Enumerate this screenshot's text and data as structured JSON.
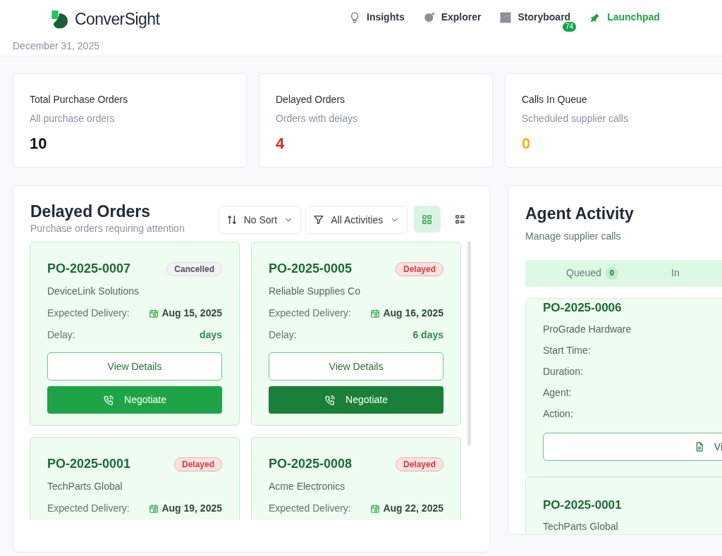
{
  "header": {
    "brand": "ConverSight",
    "date": "December 31, 2025",
    "nav": [
      {
        "label": "Insights",
        "kind": "insights",
        "selected": false
      },
      {
        "label": "Explorer",
        "kind": "explorer",
        "selected": false
      },
      {
        "label": "Storyboard",
        "kind": "storyboard",
        "selected": false,
        "badge": "74"
      },
      {
        "label": "Launchpad",
        "kind": "launchpad",
        "selected": true
      }
    ]
  },
  "stats": [
    {
      "title": "Total Purchase Orders",
      "subtitle": "All purchase orders",
      "value": "10",
      "color": "#111111"
    },
    {
      "title": "Delayed Orders",
      "subtitle": "Orders with delays",
      "value": "4",
      "color": "#dc2626"
    },
    {
      "title": "Calls In Queue",
      "subtitle": "Scheduled supplier calls",
      "value": "0",
      "color": "#f5b014"
    }
  ],
  "delayed_orders": {
    "title": "Delayed Orders",
    "subtitle": "Purchase orders requiring attention",
    "sort": {
      "label": "No Sort"
    },
    "filter": {
      "label": "All Activities"
    },
    "views": [
      {
        "kind": "grid",
        "selected": true
      },
      {
        "kind": "list",
        "selected": false
      }
    ],
    "orders": [
      {
        "id": "PO-2025-0007",
        "status": "Cancelled",
        "kind": "cancelled",
        "supplier": "DeviceLink Solutions",
        "delivery_label": "Expected Delivery:",
        "delivery": "Aug 15, 2025",
        "delay_label": "Delay:",
        "delay": "days",
        "view_label": "View Details",
        "negotiate_label": "Negotiate",
        "negotiate_hovered": false
      },
      {
        "id": "PO-2025-0005",
        "status": "Delayed",
        "kind": "delayed",
        "supplier": "Reliable Supplies Co",
        "delivery_label": "Expected Delivery:",
        "delivery": "Aug 16, 2025",
        "delay_label": "Delay:",
        "delay": "6 days",
        "view_label": "View Details",
        "negotiate_label": "Negotiate",
        "negotiate_hovered": true
      },
      {
        "id": "PO-2025-0001",
        "status": "Delayed",
        "kind": "delayed",
        "supplier": "TechParts Global",
        "delivery_label": "Expected Delivery:",
        "delivery": "Aug 19, 2025"
      },
      {
        "id": "PO-2025-0008",
        "status": "Delayed",
        "kind": "delayed",
        "supplier": "Acme Electronics",
        "delivery_label": "Expected Delivery:",
        "delivery": "Aug 22, 2025"
      }
    ]
  },
  "agent_activity": {
    "title": "Agent Activity",
    "subtitle": "Manage supplier calls",
    "tabs": [
      {
        "label": "Queued",
        "count": "0",
        "selected": false
      },
      {
        "label": "In",
        "selected": false
      }
    ],
    "calls": [
      {
        "id": "PO-2025-0006",
        "supplier": "ProGrade Hardware",
        "fields": [
          "Start Time:",
          "Duration:",
          "Agent:",
          "Action:"
        ],
        "button": "Vi"
      },
      {
        "id": "PO-2025-0001",
        "supplier": "TechParts Global"
      }
    ]
  }
}
